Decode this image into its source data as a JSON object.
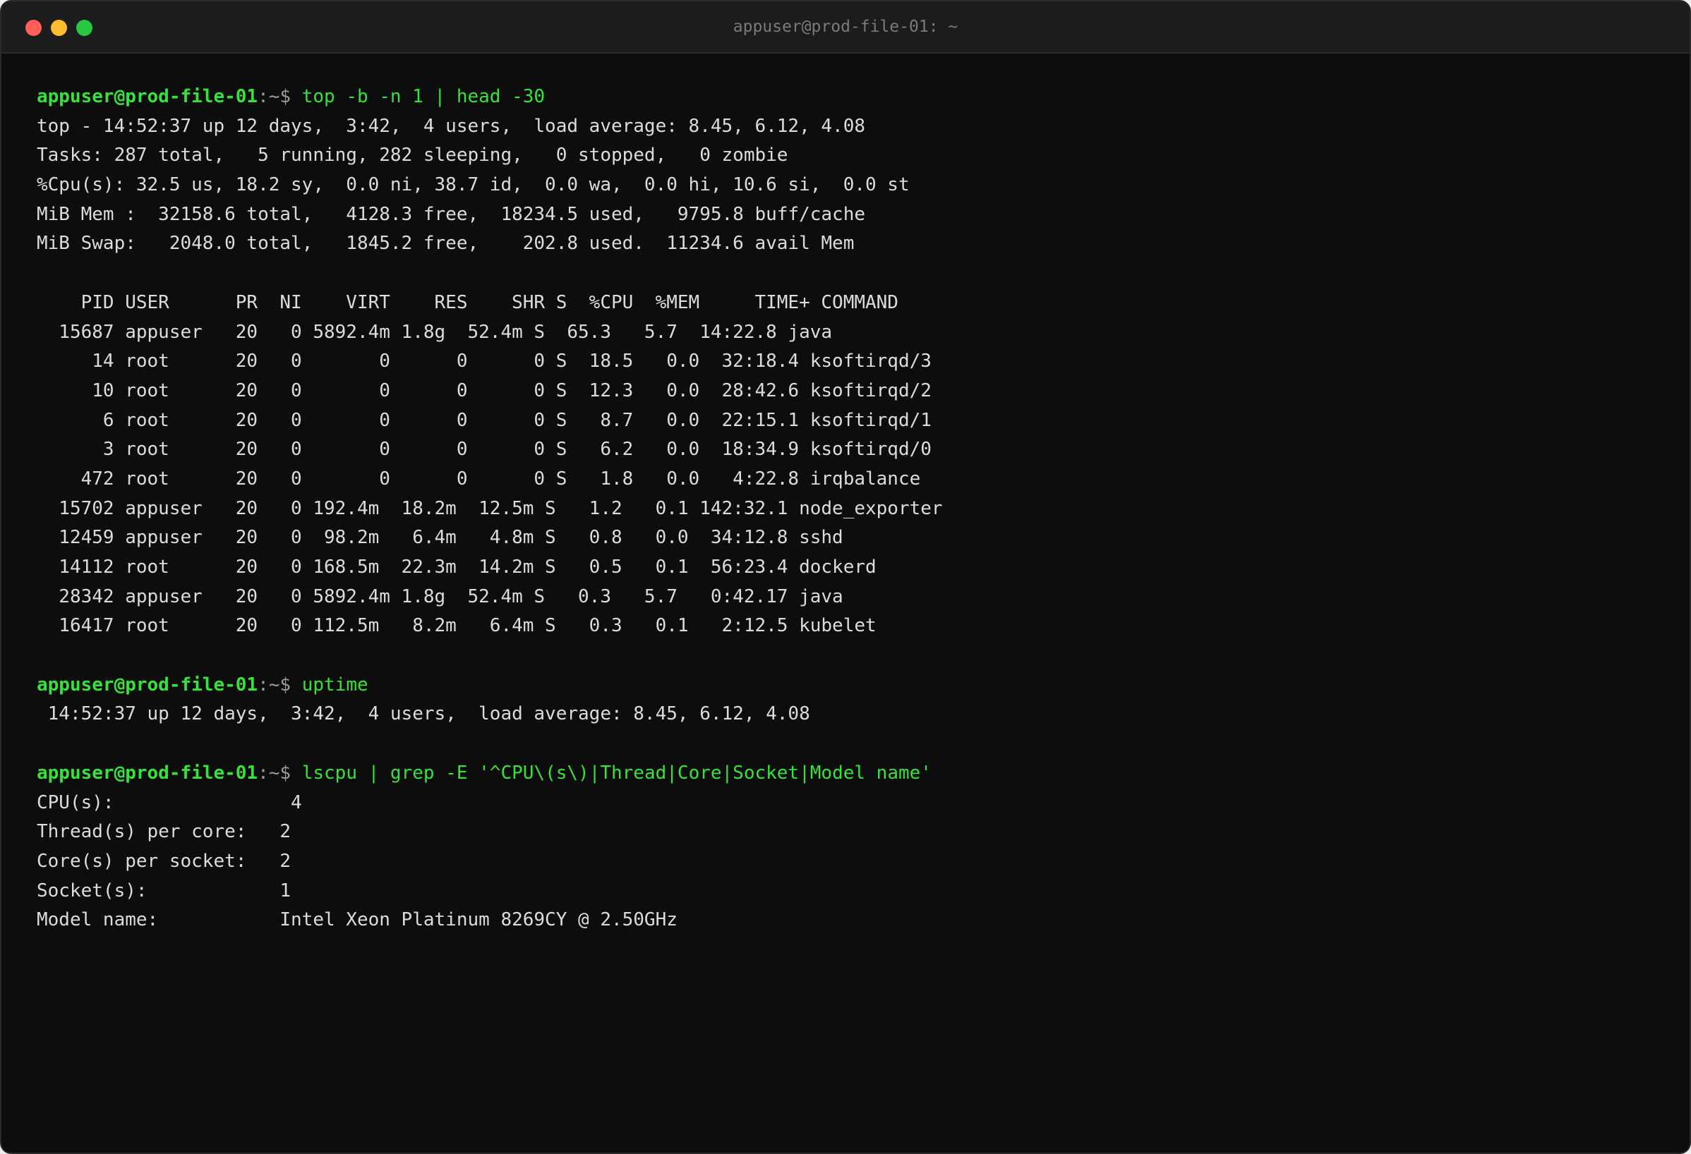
{
  "window": {
    "title": "appuser@prod-file-01: ~"
  },
  "prompt": {
    "host": "appuser@prod-file-01",
    "suffix": ":~$ "
  },
  "colors": {
    "prompt_green": "#35e33a",
    "text": "#dcdcdc",
    "background": "#0d0d0d"
  },
  "blocks": [
    {
      "command": "top -b -n 1 | head -30",
      "output": [
        "top - 14:52:37 up 12 days,  3:42,  4 users,  load average: 8.45, 6.12, 4.08",
        "Tasks: 287 total,   5 running, 282 sleeping,   0 stopped,   0 zombie",
        "%Cpu(s): 32.5 us, 18.2 sy,  0.0 ni, 38.7 id,  0.0 wa,  0.0 hi, 10.6 si,  0.0 st",
        "MiB Mem :  32158.6 total,   4128.3 free,  18234.5 used,   9795.8 buff/cache",
        "MiB Swap:   2048.0 total,   1845.2 free,    202.8 used.  11234.6 avail Mem",
        "",
        "    PID USER      PR  NI    VIRT    RES    SHR S  %CPU  %MEM     TIME+ COMMAND",
        "  15687 appuser   20   0 5892.4m 1.8g  52.4m S  65.3   5.7  14:22.8 java",
        "     14 root      20   0       0      0      0 S  18.5   0.0  32:18.4 ksoftirqd/3",
        "     10 root      20   0       0      0      0 S  12.3   0.0  28:42.6 ksoftirqd/2",
        "      6 root      20   0       0      0      0 S   8.7   0.0  22:15.1 ksoftirqd/1",
        "      3 root      20   0       0      0      0 S   6.2   0.0  18:34.9 ksoftirqd/0",
        "    472 root      20   0       0      0      0 S   1.8   0.0   4:22.8 irqbalance",
        "  15702 appuser   20   0 192.4m  18.2m  12.5m S   1.2   0.1 142:32.1 node_exporter",
        "  12459 appuser   20   0  98.2m   6.4m   4.8m S   0.8   0.0  34:12.8 sshd",
        "  14112 root      20   0 168.5m  22.3m  14.2m S   0.5   0.1  56:23.4 dockerd",
        "  28342 appuser   20   0 5892.4m 1.8g  52.4m S   0.3   5.7   0:42.17 java",
        "  16417 root      20   0 112.5m   8.2m   6.4m S   0.3   0.1   2:12.5 kubelet",
        ""
      ]
    },
    {
      "command": "uptime",
      "output": [
        " 14:52:37 up 12 days,  3:42,  4 users,  load average: 8.45, 6.12, 4.08",
        ""
      ]
    },
    {
      "command": "lscpu | grep -E '^CPU\\(s\\)|Thread|Core|Socket|Model name'",
      "output": [
        "CPU(s):                4",
        "Thread(s) per core:   2",
        "Core(s) per socket:   2",
        "Socket(s):            1",
        "Model name:           Intel Xeon Platinum 8269CY @ 2.50GHz"
      ]
    }
  ]
}
